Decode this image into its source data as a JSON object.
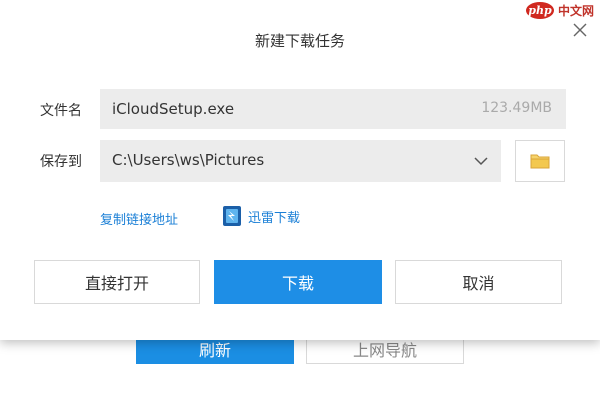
{
  "background": {
    "primary_button_label": "刷新",
    "secondary_button_label": "上网导航"
  },
  "watermark": {
    "logo_text": "php",
    "site_text": "中文网"
  },
  "dialog": {
    "title": "新建下载任务",
    "close_icon": "close-icon",
    "filename": {
      "label": "文件名",
      "value": "iCloudSetup.exe",
      "size": "123.49MB"
    },
    "save_to": {
      "label": "保存到",
      "path": "C:\\Users\\ws\\Pictures",
      "dropdown_icon": "chevron-down-icon",
      "browse_icon": "folder-icon"
    },
    "links": {
      "copy_link": "复制链接地址",
      "xunlei": "迅雷下载",
      "xunlei_icon": "xunlei-icon"
    },
    "buttons": {
      "open": "直接打开",
      "download": "下载",
      "cancel": "取消"
    },
    "colors": {
      "accent": "#1e8ee6",
      "link": "#1a7fd6",
      "field_bg": "#ececec"
    }
  }
}
